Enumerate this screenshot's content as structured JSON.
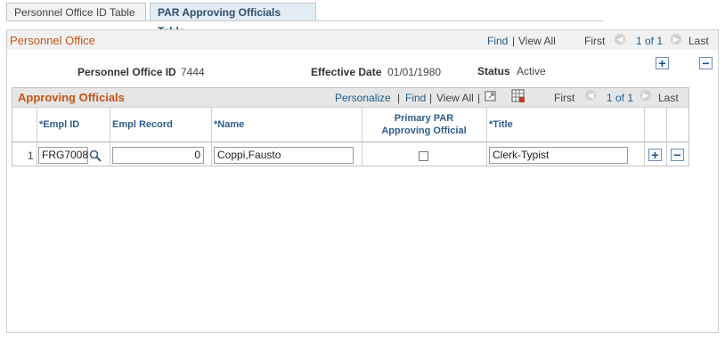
{
  "tabs": [
    {
      "label": "Personnel Office ID Table"
    },
    {
      "label": "PAR Approving Officials Table"
    }
  ],
  "personnel_office": {
    "title": "Personnel Office",
    "nav": {
      "find": "Find",
      "sep": "|",
      "view_all": "View All",
      "first": "First",
      "range": "1 of 1",
      "last": "Last"
    },
    "fields": {
      "office_id_label": "Personnel Office ID",
      "office_id_value": "7444",
      "effective_date_label": "Effective Date",
      "effective_date_value": "01/01/1980",
      "status_label": "Status",
      "status_value": "Active"
    }
  },
  "approving_officials": {
    "title": "Approving Officials",
    "nav": {
      "personalize": "Personalize",
      "sep": "|",
      "find": "Find",
      "view_all": "View All",
      "first": "First",
      "range": "1 of 1",
      "last": "Last"
    },
    "columns": [
      "*Empl ID",
      "Empl Record",
      "*Name",
      "Primary PAR Approving Official",
      "*Title"
    ],
    "rows": [
      {
        "num": "1",
        "empl_id": "FRG7008",
        "empl_record": "0",
        "name": "Coppi,Fausto",
        "primary": false,
        "title": "Clerk-Typist"
      }
    ]
  },
  "icons": {
    "add": "+",
    "delete": "−",
    "prev": "◀",
    "next": "▶",
    "search": "magnifier",
    "zoom": "zoom-icon",
    "download": "grid-icon"
  }
}
